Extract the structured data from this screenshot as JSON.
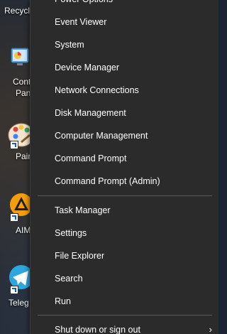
{
  "desktop": {
    "icons": [
      {
        "name": "recycle-bin",
        "label": "Recycle"
      },
      {
        "name": "control-panel",
        "label_line1": "Cont",
        "label_line2": "Pan"
      },
      {
        "name": "paint",
        "label": "Pair"
      },
      {
        "name": "aimp",
        "label": "AIM"
      },
      {
        "name": "telegram",
        "label": "Teleg"
      }
    ]
  },
  "menu": {
    "items": [
      {
        "label": "Power Options"
      },
      {
        "label": "Event Viewer"
      },
      {
        "label": "System"
      },
      {
        "label": "Device Manager"
      },
      {
        "label": "Network Connections"
      },
      {
        "label": "Disk Management"
      },
      {
        "label": "Computer Management"
      },
      {
        "label": "Command Prompt"
      },
      {
        "label": "Command Prompt (Admin)"
      },
      {
        "label": "Task Manager"
      },
      {
        "label": "Settings"
      },
      {
        "label": "File Explorer"
      },
      {
        "label": "Search"
      },
      {
        "label": "Run"
      },
      {
        "label": "Shut down or sign out",
        "submenu_icon": "chevron-right-icon"
      }
    ]
  },
  "colors": {
    "menu_bg": "#2b2b2b",
    "menu_text": "#ffffff",
    "separator": "#5a5a5a"
  }
}
